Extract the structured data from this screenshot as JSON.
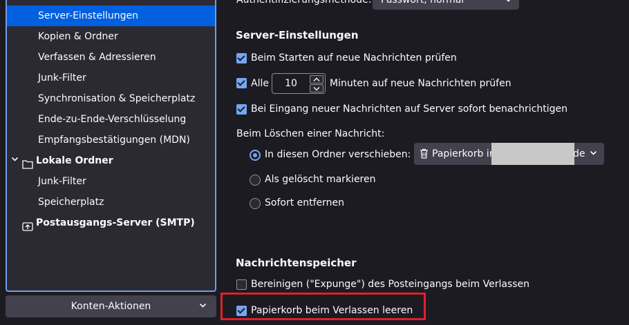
{
  "sidebar": {
    "items": [
      {
        "label": "Server-Einstellungen",
        "selected": true
      },
      {
        "label": "Kopien & Ordner"
      },
      {
        "label": "Verfassen & Adressieren"
      },
      {
        "label": "Junk-Filter"
      },
      {
        "label": "Synchronisation & Speicherplatz"
      },
      {
        "label": "Ende-zu-Ende-Verschlüsselung"
      },
      {
        "label": "Empfangsbestätigungen (MDN)"
      }
    ],
    "local_folders": {
      "label": "Lokale Ordner",
      "icon": "folder-icon",
      "children": [
        {
          "label": "Junk-Filter"
        },
        {
          "label": "Speicherplatz"
        }
      ]
    },
    "smtp": {
      "label": "Postausgangs-Server (SMTP)",
      "icon": "outgoing-server-icon"
    },
    "account_actions_label": "Konten-Aktionen",
    "accent": "#0060df"
  },
  "auth": {
    "label": "Authentifizierungsmethode:",
    "value": "Passwort, normal"
  },
  "server_settings": {
    "title": "Server-Einstellungen",
    "check_on_start": {
      "label": "Beim Starten auf neue Nachrichten prüfen",
      "checked": true
    },
    "check_every": {
      "pre": "Alle",
      "value": "10",
      "post": "Minuten auf neue Nachrichten prüfen",
      "checked": true
    },
    "notify_new": {
      "label": "Bei Eingang neuer Nachrichten auf Server sofort benachrichtigen",
      "checked": true
    },
    "on_delete_label": "Beim Löschen einer Nachricht:",
    "move_to_folder": {
      "label": "In diesen Ordner verschieben:",
      "selected": true
    },
    "folder_select_value": "Papierkorb in",
    "folder_select_tail": "de",
    "mark_deleted": {
      "label": "Als gelöscht markieren"
    },
    "remove_immediately": {
      "label": "Sofort entfernen"
    }
  },
  "message_storage": {
    "title": "Nachrichtenspeicher",
    "expunge_inbox": {
      "label": "Bereinigen (\"Expunge\") des Posteingangs beim Verlassen",
      "checked": false
    },
    "empty_trash": {
      "label": "Papierkorb beim Verlassen leeren",
      "checked": true
    }
  },
  "colors": {
    "highlight_box": "#e0202a",
    "checkbox_accent": "#73a7f3"
  }
}
